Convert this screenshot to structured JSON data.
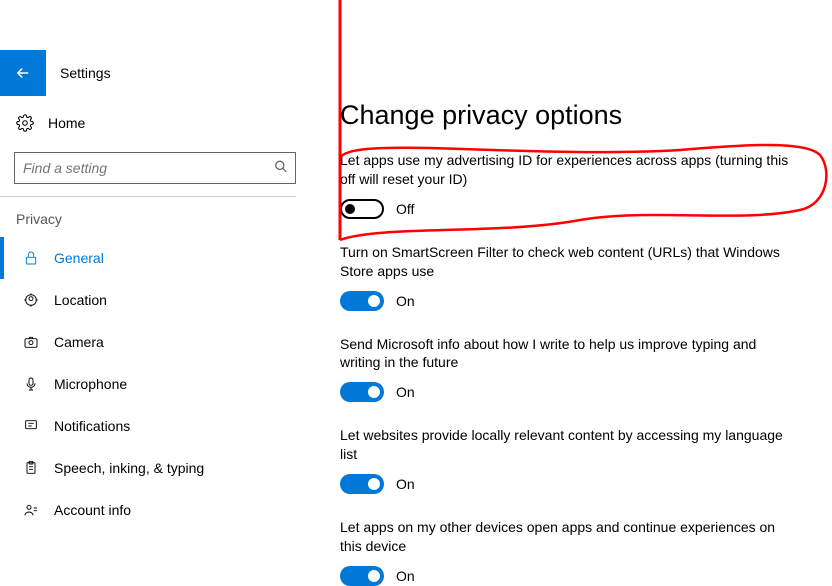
{
  "header": {
    "app_title": "Settings"
  },
  "search": {
    "placeholder": "Find a setting"
  },
  "sidebar": {
    "home_label": "Home",
    "section_label": "Privacy",
    "items": [
      {
        "label": "General"
      },
      {
        "label": "Location"
      },
      {
        "label": "Camera"
      },
      {
        "label": "Microphone"
      },
      {
        "label": "Notifications"
      },
      {
        "label": "Speech, inking, & typing"
      },
      {
        "label": "Account info"
      }
    ]
  },
  "main": {
    "page_title": "Change privacy options",
    "settings": [
      {
        "desc": "Let apps use my advertising ID for experiences across apps (turning this off will reset your ID)",
        "state": "off",
        "state_label": "Off"
      },
      {
        "desc": "Turn on SmartScreen Filter to check web content (URLs) that Windows Store apps use",
        "state": "on",
        "state_label": "On"
      },
      {
        "desc": "Send Microsoft info about how I write to help us improve typing and writing in the future",
        "state": "on",
        "state_label": "On"
      },
      {
        "desc": "Let websites provide locally relevant content by accessing my language list",
        "state": "on",
        "state_label": "On"
      },
      {
        "desc": "Let apps on my other devices open apps and continue experiences on this device",
        "state": "on",
        "state_label": "On"
      }
    ]
  }
}
